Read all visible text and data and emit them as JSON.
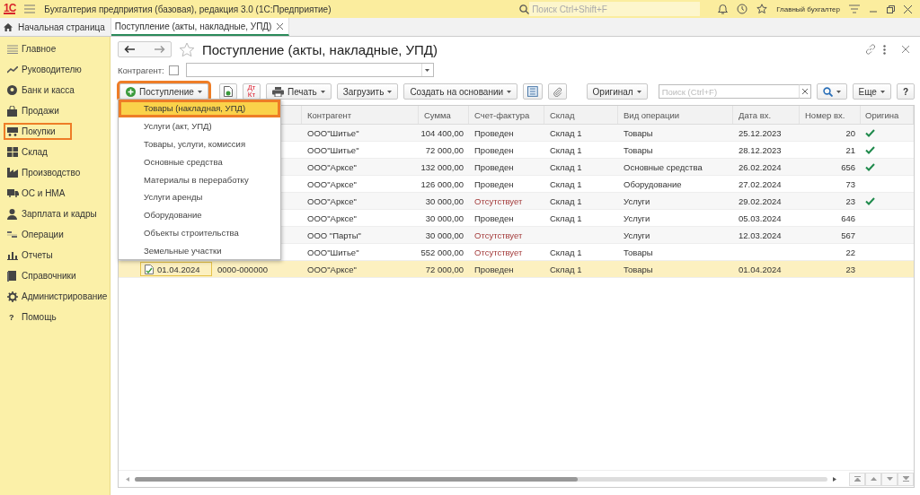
{
  "app_bar": {
    "logo": "1С",
    "title": "Бухгалтерия предприятия (базовая), редакция 3.0  (1С:Предприятие)",
    "search": {
      "placeholder": "Поиск Ctrl+Shift+F"
    },
    "user": "Главный бухгалтер"
  },
  "tabs": [
    {
      "label": "Начальная страница",
      "selected": false,
      "closable": false
    },
    {
      "label": "Поступление (акты, накладные, УПД)",
      "selected": true,
      "closable": true
    }
  ],
  "sidebar": {
    "items": [
      {
        "label": "Главное",
        "highlighted": false
      },
      {
        "label": "Руководителю",
        "highlighted": false
      },
      {
        "label": "Банк и касса",
        "highlighted": false
      },
      {
        "label": "Продажи",
        "highlighted": false
      },
      {
        "label": "Покупки",
        "highlighted": true
      },
      {
        "label": "Склад",
        "highlighted": false
      },
      {
        "label": "Производство",
        "highlighted": false
      },
      {
        "label": "ОС и НМА",
        "highlighted": false
      },
      {
        "label": "Зарплата и кадры",
        "highlighted": false
      },
      {
        "label": "Операции",
        "highlighted": false
      },
      {
        "label": "Отчеты",
        "highlighted": false
      },
      {
        "label": "Справочники",
        "highlighted": false
      },
      {
        "label": "Администрирование",
        "highlighted": false
      },
      {
        "label": "Помощь",
        "highlighted": false,
        "glyph": "?"
      }
    ]
  },
  "form": {
    "title": "Поступление (акты, накладные, УПД)",
    "counterparty_filter": {
      "label": "Контрагент:",
      "checked": false
    },
    "toolbar": {
      "create_button": {
        "label": "Поступление",
        "highlighted": true
      },
      "dtkt": [
        "Дт",
        "Кт"
      ],
      "print": "Печать",
      "load": "Загрузить",
      "create_based": "Создать на основании",
      "original": "Оригинал",
      "search": {
        "placeholder": "Поиск (Ctrl+F)"
      },
      "more": "Еще",
      "help": "?"
    },
    "create_menu": [
      {
        "label": "Товары (накладная, УПД)",
        "selected": true
      },
      {
        "label": "Услуги (акт, УПД)",
        "selected": false
      },
      {
        "label": "Товары, услуги, комиссия",
        "selected": false
      },
      {
        "label": "Основные средства",
        "selected": false
      },
      {
        "label": "Материалы в переработку",
        "selected": false
      },
      {
        "label": "Услуги аренды",
        "selected": false
      },
      {
        "label": "Оборудование",
        "selected": false
      },
      {
        "label": "Объекты строительства",
        "selected": false
      },
      {
        "label": "Земельные участки",
        "selected": false
      }
    ],
    "table": {
      "columns": [
        "Контрагент",
        "Сумма",
        "Счет-фактура",
        "Склад",
        "Вид операции",
        "Дата вх.",
        "Номер вх.",
        "Оригина"
      ],
      "rows": [
        {
          "selected": false,
          "counterparty": "ООО\"Шитье\"",
          "sum": "104 400,00",
          "invoice": {
            "text": "Проведен",
            "kind": "posted"
          },
          "warehouse": "Склад 1",
          "operation": "Товары",
          "in_date": "25.12.2023",
          "in_number": "20",
          "original": true
        },
        {
          "selected": false,
          "counterparty": "ООО\"Шитье\"",
          "sum": "72 000,00",
          "invoice": {
            "text": "Проведен",
            "kind": "posted"
          },
          "warehouse": "Склад 1",
          "operation": "Товары",
          "in_date": "28.12.2023",
          "in_number": "21",
          "original": true
        },
        {
          "selected": false,
          "counterparty": "ООО\"Арксе\"",
          "sum": "132 000,00",
          "invoice": {
            "text": "Проведен",
            "kind": "posted"
          },
          "warehouse": "Склад 1",
          "operation": "Основные средства",
          "in_date": "26.02.2024",
          "in_number": "656",
          "original": true
        },
        {
          "selected": false,
          "counterparty": "ООО\"Арксе\"",
          "sum": "126 000,00",
          "invoice": {
            "text": "Проведен",
            "kind": "posted"
          },
          "warehouse": "Склад 1",
          "operation": "Оборудование",
          "in_date": "27.02.2024",
          "in_number": "73",
          "original": false
        },
        {
          "selected": false,
          "counterparty": "ООО\"Арксе\"",
          "sum": "30 000,00",
          "invoice": {
            "text": "Отсутствует",
            "kind": "missing"
          },
          "warehouse": "Склад 1",
          "operation": "Услуги",
          "in_date": "29.02.2024",
          "in_number": "23",
          "original": true
        },
        {
          "selected": false,
          "counterparty": "ООО\"Арксе\"",
          "sum": "30 000,00",
          "invoice": {
            "text": "Проведен",
            "kind": "posted"
          },
          "warehouse": "Склад 1",
          "operation": "Услуги",
          "in_date": "05.03.2024",
          "in_number": "646",
          "original": false
        },
        {
          "selected": false,
          "counterparty": "ООО \"Парты\"",
          "sum": "30 000,00",
          "invoice": {
            "text": "Отсутствует",
            "kind": "missing"
          },
          "operation": "Услуги",
          "in_date": "12.03.2024",
          "in_number": "567",
          "original": false
        },
        {
          "selected": false,
          "counterparty": "ООО\"Шитье\"",
          "sum": "552 000,00",
          "invoice": {
            "text": "Отсутствует",
            "kind": "missing"
          },
          "warehouse": "Склад 1",
          "operation": "Товары",
          "in_number": "22",
          "original": false
        },
        {
          "selected": true,
          "date": "01.04.2024",
          "number": "0000-000000",
          "counterparty": "ООО\"Арксе\"",
          "sum": "72 000,00",
          "invoice": {
            "text": "Проведен",
            "kind": "posted"
          },
          "warehouse": "Склад 1",
          "operation": "Товары",
          "in_date": "01.04.2024",
          "in_number": "23",
          "original": false
        }
      ]
    }
  }
}
